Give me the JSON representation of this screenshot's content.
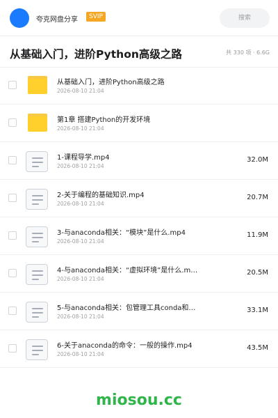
{
  "header": {
    "username": "夸克网盘分享",
    "badge": "SVIP",
    "search_placeholder": "搜索"
  },
  "folder": {
    "title": "从基础入门，进阶Python高级之路",
    "meta": "共 330 项 · 6.6G"
  },
  "items": [
    {
      "type": "folder",
      "name": "从基础入门，进阶Python高级之路",
      "date": "2026-08-10 21:04",
      "size": ""
    },
    {
      "type": "folder",
      "name": "第1章 搭建Python的开发环境",
      "date": "2026-08-10 21:04",
      "size": ""
    },
    {
      "type": "file",
      "name": "1-课程导学.mp4",
      "date": "2026-08-10 21:04",
      "size": "32.0M"
    },
    {
      "type": "file",
      "name": "2-关于编程的基础知识.mp4",
      "date": "2026-08-10 21:04",
      "size": "20.7M"
    },
    {
      "type": "file",
      "name": "3-与anaconda相关：“模块”是什么.mp4",
      "date": "2026-08-10 21:04",
      "size": "11.9M"
    },
    {
      "type": "file",
      "name": "4-与anaconda相关：“虚拟环境”是什么.m…",
      "date": "2026-08-10 21:04",
      "size": "20.5M"
    },
    {
      "type": "file",
      "name": "5-与anaconda相关：包管理工具conda和…",
      "date": "2026-08-10 21:04",
      "size": "33.1M"
    },
    {
      "type": "file",
      "name": "6-关于anaconda的命令：一般的操作.mp4",
      "date": "2026-08-10 21:04",
      "size": "43.5M"
    }
  ],
  "watermark": "miosou.cc",
  "colors": {
    "avatar": "#1a7bff",
    "badge": "#f5a623",
    "folder_icon": "#ffd02b",
    "watermark": "#2fb54a"
  }
}
